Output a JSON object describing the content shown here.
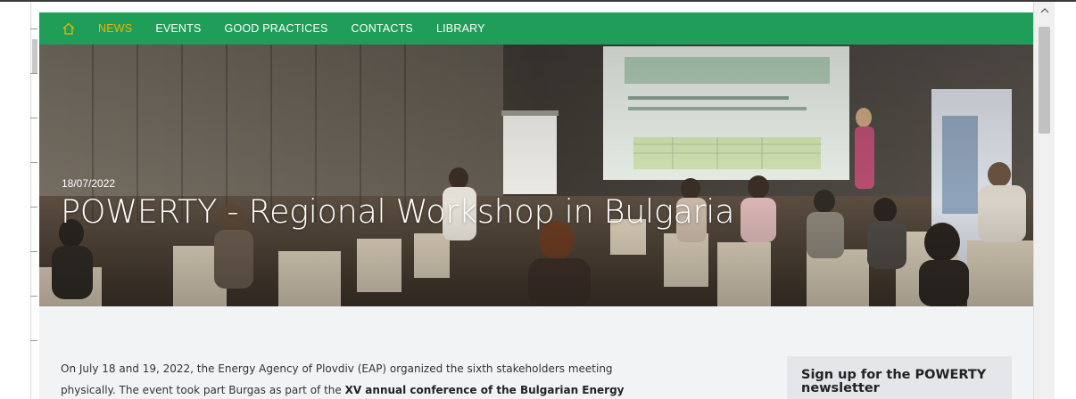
{
  "nav": {
    "home_icon": "home-icon",
    "items": [
      {
        "label": "NEWS",
        "active": true
      },
      {
        "label": "EVENTS",
        "active": false
      },
      {
        "label": "GOOD PRACTICES",
        "active": false
      },
      {
        "label": "CONTACTS",
        "active": false
      },
      {
        "label": "LIBRARY",
        "active": false
      }
    ]
  },
  "hero": {
    "date": "18/07/2022",
    "title": "POWERTY - Regional Workshop in Bulgaria"
  },
  "article": {
    "line1": "On July 18 and 19, 2022, the Energy Agency of Plovdiv (EAP) organized the sixth stakeholders meeting",
    "line2_prefix": "physically. The event took part Burgas as part of the ",
    "line2_bold": "XV annual conference of the Bulgarian Energy"
  },
  "newsletter": {
    "title": "Sign up for the POWERTY newsletter"
  },
  "colors": {
    "nav_bg": "#1e9e58",
    "nav_active": "#f0b400",
    "page_bg": "#f2f3f5"
  },
  "scrollbar": {
    "up_icon": "chevron-up-icon"
  }
}
